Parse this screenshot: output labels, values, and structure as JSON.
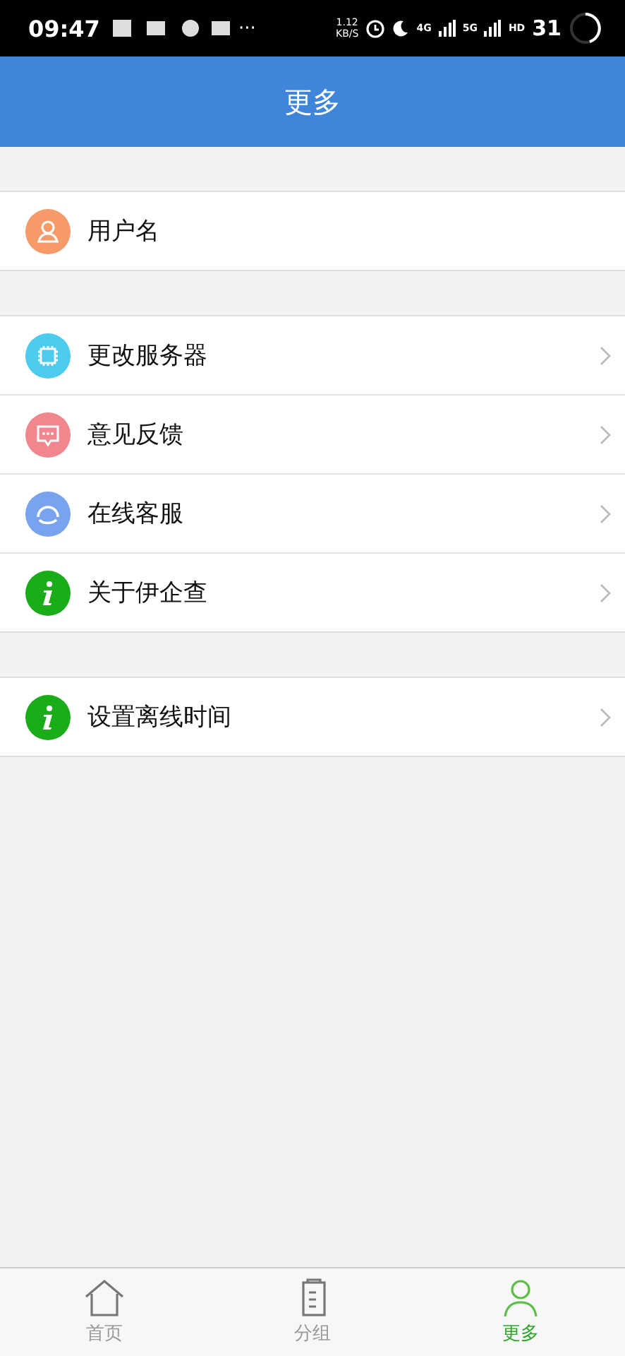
{
  "status_bar": {
    "time": "09:47",
    "more": "···",
    "speed_value": "1.12",
    "speed_unit": "KB/S",
    "network_1": "4G",
    "network_2": "5G",
    "hd": "HD",
    "battery": "31"
  },
  "header": {
    "title": "更多"
  },
  "groups": [
    {
      "items": [
        {
          "kind": "user",
          "color": "#f79a6a",
          "label": "用户名",
          "chevron": false
        }
      ]
    },
    {
      "items": [
        {
          "kind": "chip",
          "color": "#4ccbee",
          "label": "更改服务器",
          "chevron": true
        },
        {
          "kind": "chat",
          "color": "#f2868f",
          "label": "意见反馈",
          "chevron": true
        },
        {
          "kind": "headset",
          "color": "#7aa3ef",
          "label": "在线客服",
          "chevron": true
        },
        {
          "kind": "info",
          "color": "#1aad19",
          "label": "关于伊企查",
          "chevron": true
        }
      ]
    },
    {
      "items": [
        {
          "kind": "info",
          "color": "#1aad19",
          "label": "设置离线时间",
          "chevron": true
        }
      ]
    }
  ],
  "tab_bar": [
    {
      "kind": "home",
      "label": "首页",
      "selected": false
    },
    {
      "kind": "doc",
      "label": "分组",
      "selected": false
    },
    {
      "kind": "person",
      "label": "更多",
      "selected": true
    }
  ]
}
